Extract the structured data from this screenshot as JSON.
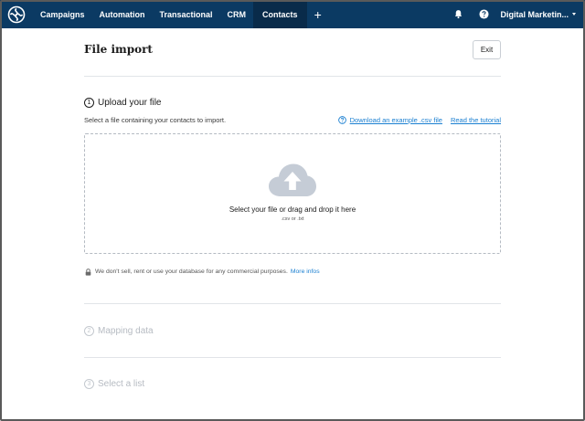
{
  "nav": {
    "items": [
      {
        "label": "Campaigns",
        "active": false
      },
      {
        "label": "Automation",
        "active": false
      },
      {
        "label": "Transactional",
        "active": false
      },
      {
        "label": "CRM",
        "active": false
      },
      {
        "label": "Contacts",
        "active": true
      }
    ],
    "plus_label": "+",
    "account_label": "Digital Marketin...",
    "icons": [
      "logo-icon",
      "bell-icon",
      "help-icon",
      "caret-down-icon"
    ],
    "colors": {
      "bar": "#0b3a63",
      "active": "#092b4a"
    }
  },
  "page": {
    "title": "File import",
    "exit_label": "Exit"
  },
  "step1": {
    "number": "1",
    "title": "Upload your file",
    "description": "Select a file containing your contacts to import.",
    "example_link": "Download an example .csv file",
    "tutorial_link": "Read the tutorial"
  },
  "dropzone": {
    "text": "Select your file or drag and drop it here",
    "formats": ".csv or .txt",
    "icon": "cloud-upload-icon"
  },
  "privacy": {
    "text": "We don't sell, rent or use your database for any commercial purposes.",
    "link": "More infos"
  },
  "step2": {
    "number": "2",
    "title": "Mapping data"
  },
  "step3": {
    "number": "3",
    "title": "Select a list"
  },
  "colors": {
    "link": "#1a7fd1",
    "muted": "#b6bbc2",
    "cloud": "#c5ccd6"
  }
}
